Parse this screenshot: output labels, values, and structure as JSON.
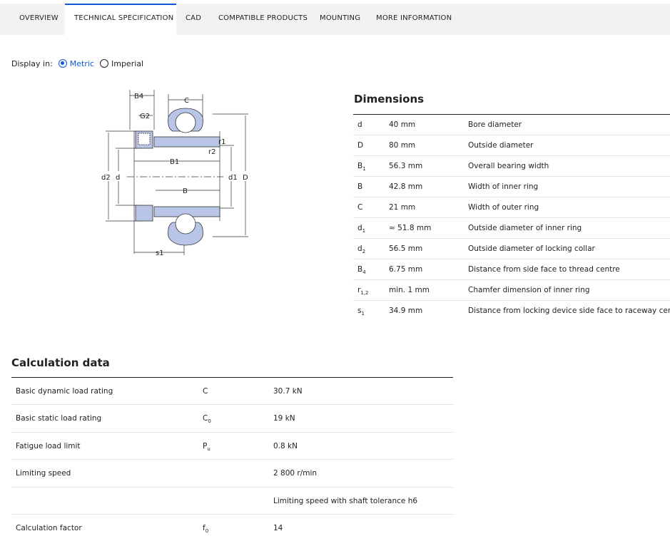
{
  "tabs": [
    {
      "label": "OVERVIEW",
      "active": false
    },
    {
      "label": "TECHNICAL SPECIFICATION",
      "active": true
    },
    {
      "label": "CAD",
      "active": false
    },
    {
      "label": "COMPATIBLE PRODUCTS",
      "active": false
    },
    {
      "label": "MOUNTING",
      "active": false
    },
    {
      "label": "MORE INFORMATION",
      "active": false
    }
  ],
  "display": {
    "label": "Display in:",
    "options": [
      {
        "label": "Metric",
        "checked": true
      },
      {
        "label": "Imperial",
        "checked": false
      }
    ]
  },
  "drawing": {
    "labels": {
      "B4": "B4",
      "G2": "G2",
      "C": "C",
      "r1": "r1",
      "r2": "r2",
      "B1": "B1",
      "B": "B",
      "d2": "d2",
      "d": "d",
      "d1": "d1",
      "D": "D",
      "s1": "s1"
    }
  },
  "dimensions": {
    "title": "Dimensions",
    "rows": [
      {
        "symbol": "d",
        "sub": "",
        "value": "40 mm",
        "desc": "Bore diameter"
      },
      {
        "symbol": "D",
        "sub": "",
        "value": "80 mm",
        "desc": "Outside diameter"
      },
      {
        "symbol": "B",
        "sub": "1",
        "value": "56.3 mm",
        "desc": "Overall bearing width"
      },
      {
        "symbol": "B",
        "sub": "",
        "value": "42.8 mm",
        "desc": "Width of inner ring"
      },
      {
        "symbol": "C",
        "sub": "",
        "value": "21 mm",
        "desc": "Width of outer ring"
      },
      {
        "symbol": "d",
        "sub": "1",
        "value": "≈ 51.8 mm",
        "desc": "Outside diameter of inner ring"
      },
      {
        "symbol": "d",
        "sub": "2",
        "value": "56.5 mm",
        "desc": "Outside diameter of locking collar"
      },
      {
        "symbol": "B",
        "sub": "4",
        "value": "6.75 mm",
        "desc": "Distance from side face to thread centre"
      },
      {
        "symbol": "r",
        "sub": "1,2",
        "value": "min. 1 mm",
        "desc": "Chamfer dimension of inner ring"
      },
      {
        "symbol": "s",
        "sub": "1",
        "value": "34.9 mm",
        "desc": "Distance from locking device side face to raceway centre"
      }
    ]
  },
  "calculation": {
    "title": "Calculation data",
    "rows": [
      {
        "name": "Basic dynamic load rating",
        "symbol": "C",
        "sub": "",
        "value": "30.7 kN"
      },
      {
        "name": "Basic static load rating",
        "symbol": "C",
        "sub": "0",
        "value": "19 kN"
      },
      {
        "name": "Fatigue load limit",
        "symbol": "P",
        "sub": "u",
        "value": "0.8 kN"
      },
      {
        "name": "Limiting speed",
        "symbol": "",
        "sub": "",
        "value": "2 800 r/min"
      },
      {
        "name": "",
        "symbol": "",
        "sub": "",
        "value": "Limiting speed with shaft tolerance h6"
      },
      {
        "name": "Calculation factor",
        "symbol": "f",
        "sub": "0",
        "value": "14"
      }
    ]
  }
}
